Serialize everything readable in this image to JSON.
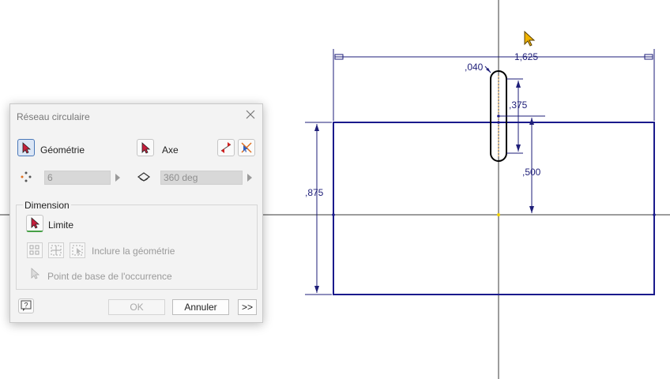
{
  "dialog": {
    "title": "Réseau circulaire",
    "geometry_label": "Géométrie",
    "axis_label": "Axe",
    "count_value": "6",
    "angle_value": "360 deg",
    "dimension_group": "Dimension",
    "limit_label": "Limite",
    "include_geometry_label": "Inclure la géométrie",
    "base_point_label": "Point de base de l'occurrence",
    "ok_label": "OK",
    "cancel_label": "Annuler",
    "more_label": ">>"
  },
  "sketch": {
    "dimensions": {
      "width": "1,625",
      "height": ",875",
      "slot_width": ",040",
      "slot_length": ",375",
      "slot_offset": ",500"
    },
    "colors": {
      "sketch_line": "#1a1a8c",
      "dimension": "#1e1e78",
      "axis": "#3a3a3a",
      "cursor": "#f0b400"
    }
  }
}
